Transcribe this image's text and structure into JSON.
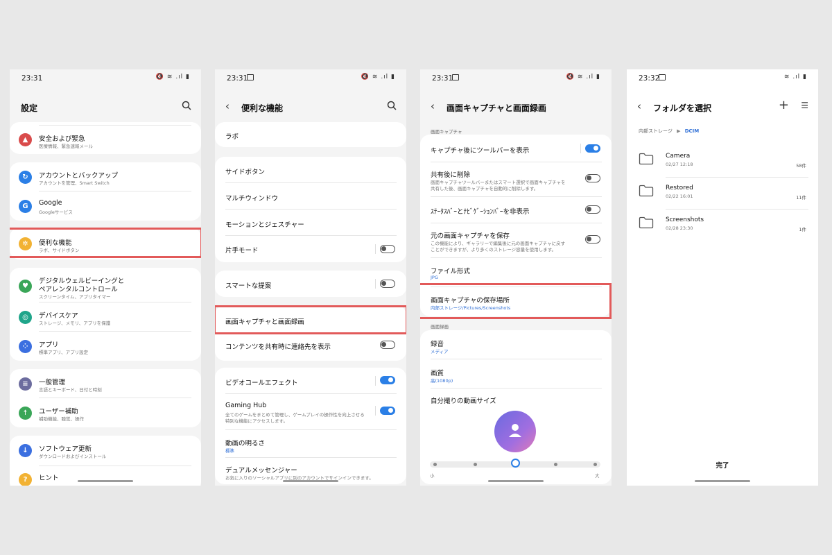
{
  "colors": {
    "highlight": "#e25a5a",
    "accent": "#2b7fe6",
    "link": "#2f6fd6"
  },
  "screen1": {
    "time": "23:31",
    "title": "設定",
    "items": [
      {
        "title": "安全および緊急",
        "sub": "医療情報、緊急速報メール",
        "icon": "siren-icon",
        "color": "#d94b4b"
      },
      {
        "title": "アカウントとバックアップ",
        "sub": "アカウントを管理、Smart Switch",
        "icon": "sync-icon",
        "color": "#2b7fe6"
      },
      {
        "title": "Google",
        "sub": "Googleサービス",
        "icon": "google-icon",
        "color": "#2b7fe6"
      },
      {
        "title": "便利な機能",
        "sub": "ラボ、サイドボタン",
        "icon": "gear-star-icon",
        "color": "#f2b233"
      },
      {
        "title": "デジタルウェルビーイングと",
        "title2": "ペアレンタルコントロール",
        "sub": "スクリーンタイム、アプリタイマー",
        "icon": "wellbeing-icon",
        "color": "#3aa658"
      },
      {
        "title": "デバイスケア",
        "sub": "ストレージ、メモリ、アプリを保護",
        "icon": "device-care-icon",
        "color": "#1fa58a"
      },
      {
        "title": "アプリ",
        "sub": "標準アプリ、アプリ設定",
        "icon": "apps-icon",
        "color": "#3b6fe0"
      },
      {
        "title": "一般管理",
        "sub": "言語とキーボード、日付と時刻",
        "icon": "sliders-icon",
        "color": "#6c6c9e"
      },
      {
        "title": "ユーザー補助",
        "sub": "補助機能、聴覚、操作",
        "icon": "accessibility-icon",
        "color": "#3aa658"
      },
      {
        "title": "ソフトウェア更新",
        "sub": "ダウンロードおよびインストール",
        "icon": "update-icon",
        "color": "#3b6fe0"
      },
      {
        "title": "ヒント",
        "icon": "tips-icon",
        "color": "#f2b233"
      }
    ]
  },
  "screen2": {
    "time": "23:31",
    "title": "便利な機能",
    "items": [
      {
        "title": "ラボ"
      },
      {
        "title": "サイドボタン"
      },
      {
        "title": "マルチウィンドウ"
      },
      {
        "title": "モーションとジェスチャー"
      },
      {
        "title": "片手モード",
        "toggle": false
      },
      {
        "title": "スマートな提案",
        "toggle": false
      },
      {
        "title": "画面キャプチャと画面録画"
      },
      {
        "title": "コンテンツを共有時に連絡先を表示",
        "toggle": false
      },
      {
        "title": "ビデオコールエフェクト",
        "toggle": true
      },
      {
        "title": "Gaming Hub",
        "sub": "全てのゲームをまとめて管理し、ゲームプレイの操作性を向上させる",
        "sub2": "特別な機能にアクセスします。",
        "toggle": true
      },
      {
        "title": "動画の明るさ",
        "sub": "標準"
      },
      {
        "title": "デュアルメッセンジャー",
        "sub": "お気に入りのソーシャルアプリに別のアカウントでサインインできます。"
      }
    ]
  },
  "screen3": {
    "time": "23:31",
    "title": "画面キャプチャと画面録画",
    "section1": "画面キャプチャ",
    "section2": "画面録画",
    "items": [
      {
        "title": "キャプチャ後にツールバーを表示",
        "toggle": true
      },
      {
        "title": "共有後に削除",
        "sub": "画面キャプチャツールバーまたはスマート選択で画面キャプチャを",
        "sub2": "共有した後、画面キャプチャを自動的に削除します。",
        "toggle": false
      },
      {
        "title": "ｽﾃｰﾀｽﾊﾞｰとﾅﾋﾞｹﾞｰｼｮﾝﾊﾞｰを非表示",
        "toggle": false
      },
      {
        "title": "元の画面キャプチャを保存",
        "sub": "この機能により、ギャラリーで編集後に元の画面キャプチャに戻す",
        "sub2": "ことができますが、より多くのストレージ容量を使用します。",
        "toggle": false
      },
      {
        "title": "ファイル形式",
        "sub": "JPG"
      },
      {
        "title": "画面キャプチャの保存場所",
        "sub": "内部ストレージ/Pictures/Screenshots"
      },
      {
        "title": "録音",
        "sub": "メディア"
      },
      {
        "title": "画質",
        "sub": "高(1080p)"
      },
      {
        "title": "自分撮りの動画サイズ"
      }
    ],
    "slider": {
      "min_label": "小",
      "max_label": "大",
      "level": 0.5
    }
  },
  "screen4": {
    "time": "23:32",
    "title": "フォルダを選択",
    "breadcrumb_root": "内部ストレージ",
    "breadcrumb_current": "DCIM",
    "folders": [
      {
        "name": "Camera",
        "date": "02/27 12:18",
        "count": "58件"
      },
      {
        "name": "Restored",
        "date": "02/22 16:01",
        "count": "11件"
      },
      {
        "name": "Screenshots",
        "date": "02/28 23:30",
        "count": "1件"
      }
    ],
    "done": "完了"
  }
}
